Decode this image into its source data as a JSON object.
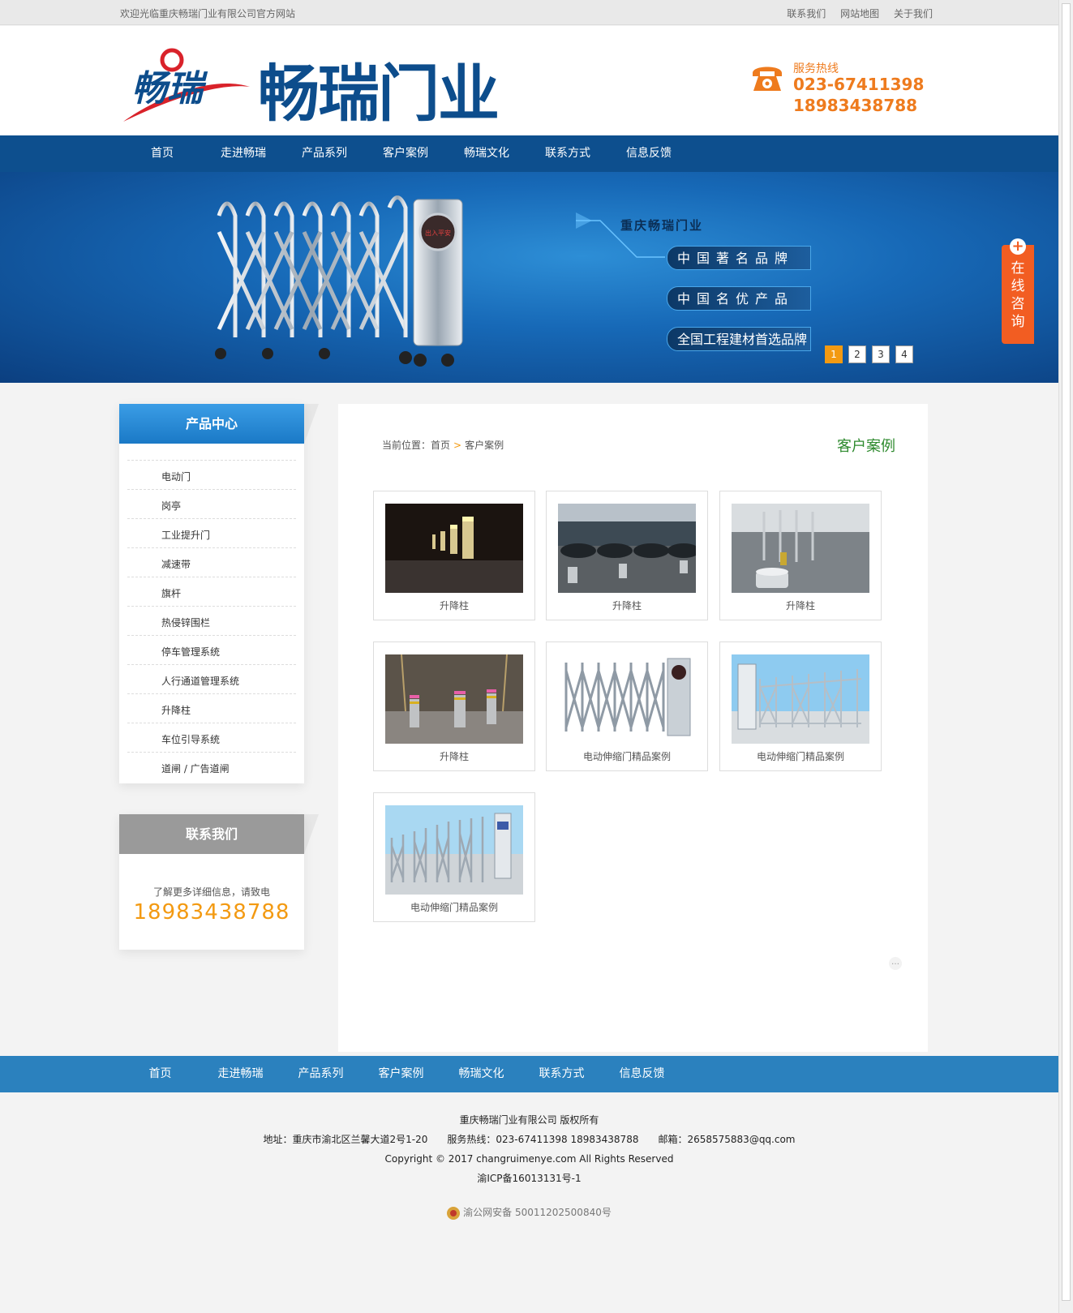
{
  "topbar": {
    "welcome": "欢迎光临重庆畅瑞门业有限公司官方网站",
    "links": [
      "联系我们",
      "网站地图",
      "关于我们"
    ]
  },
  "header": {
    "logo_text": "畅瑞",
    "brand": "畅瑞门业",
    "hotline_label": "服务热线",
    "phone1": "023-67411398",
    "phone2": "18983438788"
  },
  "nav": [
    "首页",
    "走进畅瑞",
    "产品系列",
    "客户案例",
    "畅瑞文化",
    "联系方式",
    "信息反馈"
  ],
  "banner": {
    "gate_sign": "出入平安",
    "company": "重庆畅瑞门业",
    "tag1": "中国著名品牌",
    "tag2": "中国名优产品",
    "tag3": "全国工程建材首选品牌",
    "pages": [
      "1",
      "2",
      "3",
      "4"
    ],
    "active_page": "1"
  },
  "consult": {
    "label": [
      "在",
      "线",
      "咨",
      "询"
    ]
  },
  "sidebar": {
    "products_title": "产品中心",
    "products": [
      "电动门",
      "岗亭",
      "工业提升门",
      "减速带",
      "旗杆",
      "热侵锌围栏",
      "停车管理系统",
      "人行通道管理系统",
      "升降柱",
      "车位引导系统",
      "道闸 / 广告道闸"
    ],
    "contact_title": "联系我们",
    "contact_text": "了解更多详细信息，请致电",
    "contact_phone": "18983438788"
  },
  "main": {
    "breadcrumb_prefix": "当前位置：",
    "breadcrumb_home": "首页",
    "breadcrumb_sep": ">",
    "breadcrumb_current": "客户案例",
    "title": "客户案例",
    "cases": [
      {
        "caption": "升降柱",
        "image": "bollard-night"
      },
      {
        "caption": "升降柱",
        "image": "bollard-parking"
      },
      {
        "caption": "升降柱",
        "image": "bollard-gate"
      },
      {
        "caption": "升降柱",
        "image": "bollard-lights"
      },
      {
        "caption": "电动伸缩门精品案例",
        "image": "retractable-gate"
      },
      {
        "caption": "电动伸缩门精品案例",
        "image": "retractable-gate-sky"
      },
      {
        "caption": "电动伸缩门精品案例",
        "image": "retractable-gate-long"
      }
    ],
    "pager": "…"
  },
  "footer_nav": [
    "首页",
    "走进畅瑞",
    "产品系列",
    "客户案例",
    "畅瑞文化",
    "联系方式",
    "信息反馈"
  ],
  "footer": {
    "copyright_company": "重庆畅瑞门业有限公司 版权所有",
    "address_line": "地址：重庆市渝北区兰馨大道2号1-20　　服务热线：023-67411398 18983438788　　邮箱：2658575883@qq.com",
    "copyright": "Copyright © 2017 changruimenye.com All Rights Reserved",
    "icp": "渝ICP备16013131号-1",
    "police": "渝公网安备 50011202500840号"
  },
  "colors": {
    "nav_blue": "#0d4f8e",
    "accent_orange": "#f39a12",
    "title_green": "#2e8a2e",
    "consult_orange": "#f25d22"
  }
}
